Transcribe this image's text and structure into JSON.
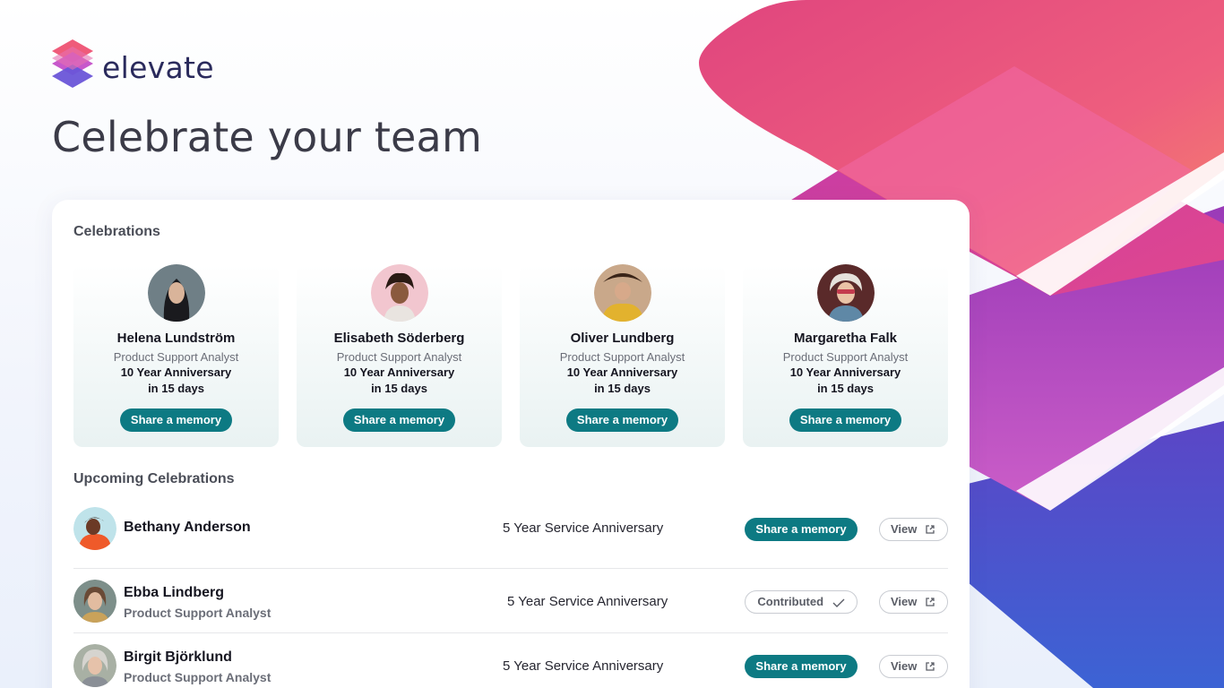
{
  "brand": {
    "name": "elevate"
  },
  "page": {
    "title": "Celebrate your team"
  },
  "celebrations": {
    "title": "Celebrations",
    "cards": [
      {
        "name": "Helena Lundström",
        "role": "Product Support Analyst",
        "anniversary": "10 Year Anniversary",
        "when": "in 15 days",
        "action": "Share a memory"
      },
      {
        "name": "Elisabeth Söderberg",
        "role": "Product Support Analyst",
        "anniversary": "10 Year Anniversary",
        "when": "in 15 days",
        "action": "Share a memory"
      },
      {
        "name": "Oliver Lundberg",
        "role": "Product Support Analyst",
        "anniversary": "10 Year Anniversary",
        "when": "in 15 days",
        "action": "Share a memory"
      },
      {
        "name": "Margaretha Falk",
        "role": "Product Support Analyst",
        "anniversary": "10 Year Anniversary",
        "when": "in 15 days",
        "action": "Share a memory"
      }
    ]
  },
  "upcoming": {
    "title": "Upcoming Celebrations",
    "rows": [
      {
        "name": "Bethany Anderson",
        "role": "",
        "anniversary": "5 Year Service Anniversary",
        "action": "Share a memory",
        "view": "View"
      },
      {
        "name": "Ebba Lindberg",
        "role": "Product Support Analyst",
        "anniversary": "5 Year Service Anniversary",
        "action": "Contributed",
        "view": "View"
      },
      {
        "name": "Birgit Björklund",
        "role": "Product Support Analyst",
        "anniversary": "5 Year Service Anniversary",
        "action": "Share a memory",
        "view": "View"
      }
    ]
  },
  "colors": {
    "accent": "#0d7a83",
    "brand_pink": "#e84a8a",
    "brand_purple": "#6a4bd6"
  }
}
